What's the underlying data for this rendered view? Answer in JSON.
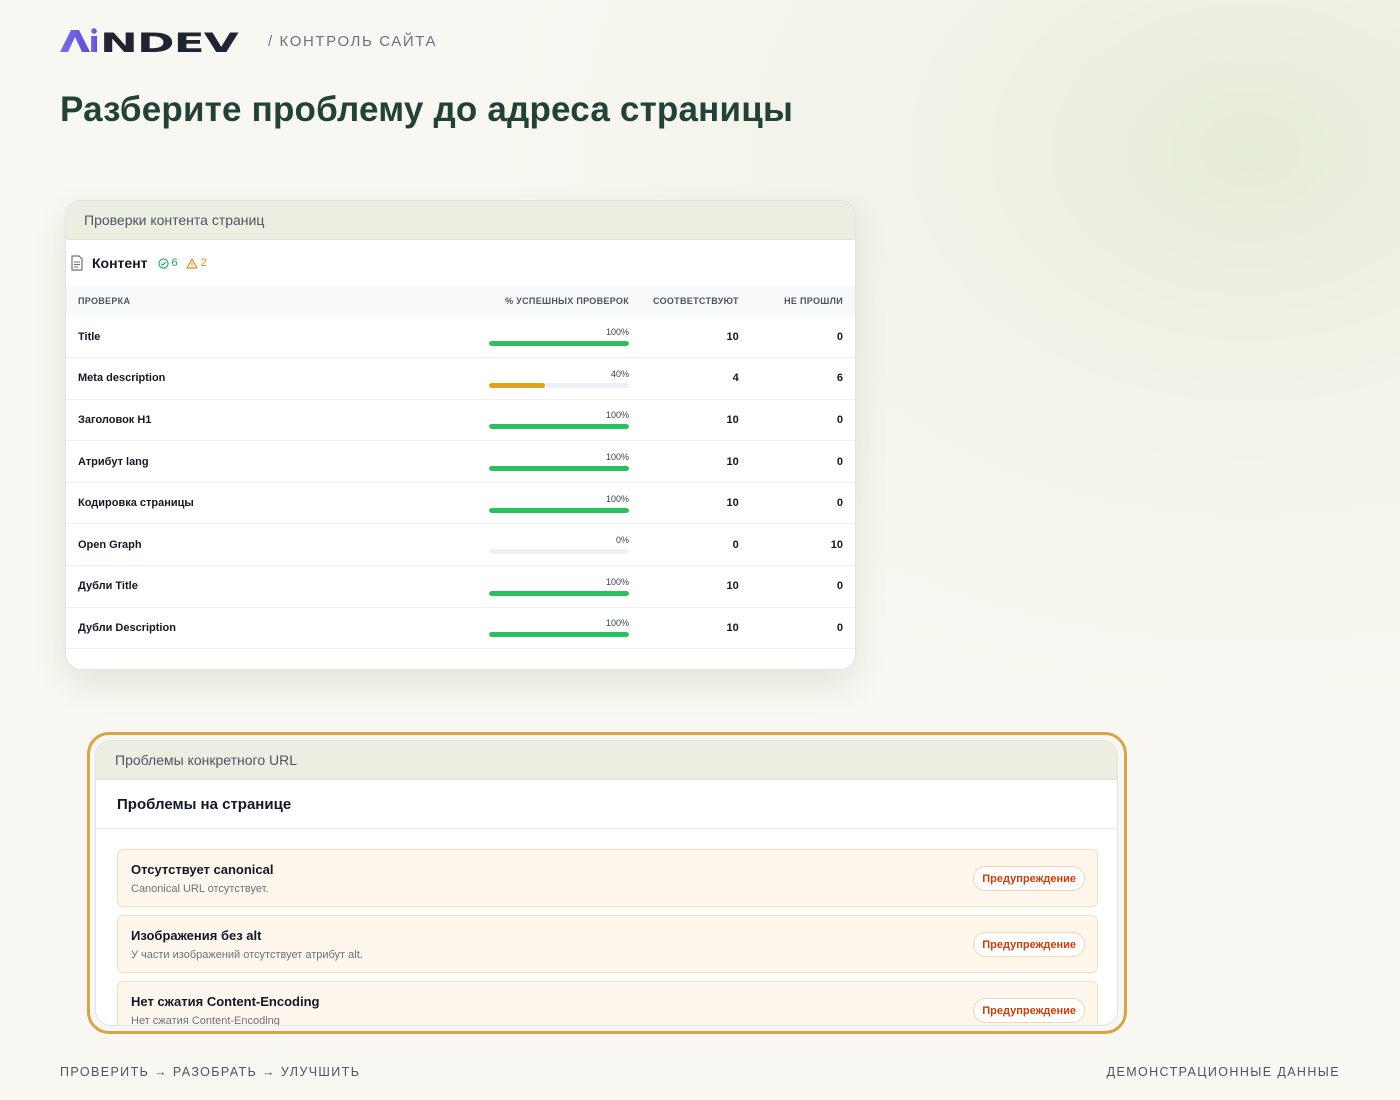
{
  "header": {
    "logo_text": "AiNDEV",
    "breadcrumb": "/ КОНТРОЛЬ САЙТА"
  },
  "page_title": "Разберите проблему до адреса страницы",
  "content_card": {
    "header_label": "Проверки контента страниц",
    "section_title": "Контент",
    "ok_count": "6",
    "warn_count": "2",
    "columns": {
      "check": "ПРОВЕРКА",
      "percent": "% УСПЕШНЫХ ПРОВЕРОК",
      "pass": "СООТВЕТСТВУЮТ",
      "fail": "НЕ ПРОШЛИ"
    },
    "rows": [
      {
        "name": "Title",
        "percent": "100%",
        "fraction": 1.0,
        "pass": "10",
        "fail": "0"
      },
      {
        "name": "Meta description",
        "percent": "40%",
        "fraction": 0.4,
        "pass": "4",
        "fail": "6"
      },
      {
        "name": "Заголовок H1",
        "percent": "100%",
        "fraction": 1.0,
        "pass": "10",
        "fail": "0"
      },
      {
        "name": "Атрибут lang",
        "percent": "100%",
        "fraction": 1.0,
        "pass": "10",
        "fail": "0"
      },
      {
        "name": "Кодировка страницы",
        "percent": "100%",
        "fraction": 1.0,
        "pass": "10",
        "fail": "0"
      },
      {
        "name": "Open Graph",
        "percent": "0%",
        "fraction": 0.0,
        "pass": "0",
        "fail": "10"
      },
      {
        "name": "Дубли Title",
        "percent": "100%",
        "fraction": 1.0,
        "pass": "10",
        "fail": "0"
      },
      {
        "name": "Дубли Description",
        "percent": "100%",
        "fraction": 1.0,
        "pass": "10",
        "fail": "0"
      }
    ]
  },
  "url_card": {
    "header_label": "Проблемы конкретного URL",
    "title": "Проблемы на странице",
    "issues": [
      {
        "title": "Отсутствует canonical",
        "description": "Canonical URL отсутствует.",
        "badge": "Предупреждение"
      },
      {
        "title": "Изображения без alt",
        "description": "У части изображений отсутствует атрибут alt.",
        "badge": "Предупреждение"
      },
      {
        "title": "Нет сжатия Content-Encoding",
        "description": "Нет сжатия Content-Encoding",
        "badge": "Предупреждение"
      }
    ]
  },
  "footer": {
    "left": "ПРОВЕРИТЬ → РАЗОБРАТЬ → УЛУЧШИТЬ",
    "right": "ДЕМОНСТРАЦИОННЫЕ ДАННЫЕ"
  },
  "colors": {
    "bar_ok": "#2bbf5f",
    "bar_warn": "#e0a21f",
    "accent_ring": "#d6a54a",
    "title": "#234236"
  }
}
